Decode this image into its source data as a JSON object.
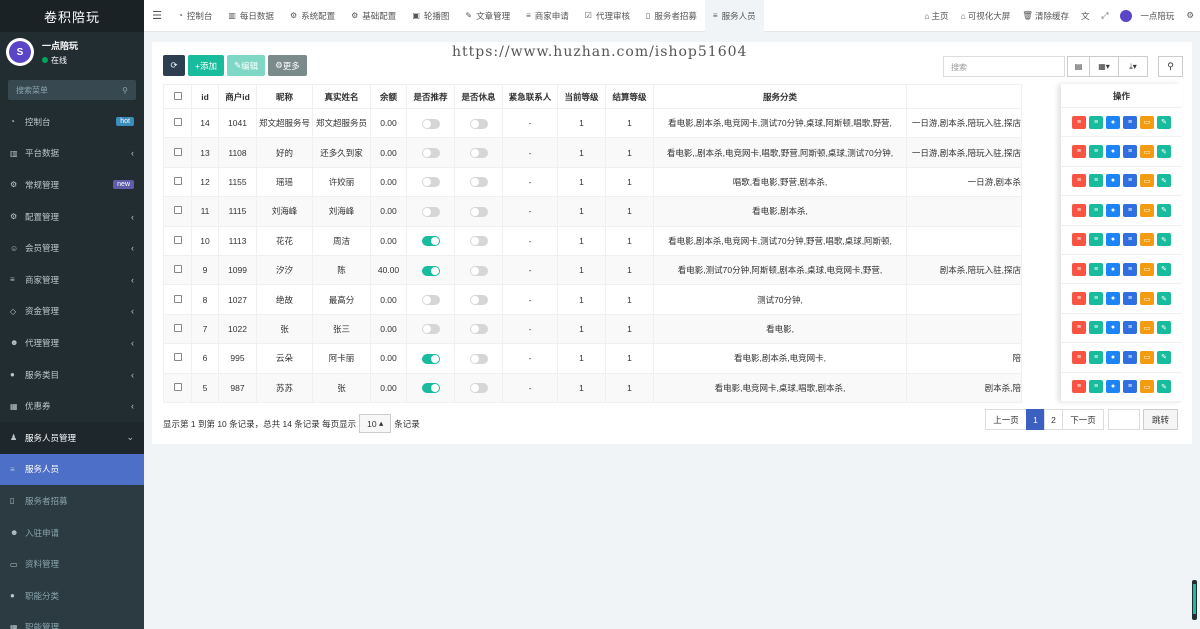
{
  "sidebar": {
    "title": "卷积陪玩",
    "user_name": "一点陪玩",
    "user_status": "在线",
    "search_placeholder": "搜索菜单",
    "items": [
      {
        "label": "控制台",
        "icon": "dashboard-icon",
        "badge": "hot"
      },
      {
        "label": "平台数据",
        "icon": "chart-icon"
      },
      {
        "label": "常规管理",
        "icon": "cogs-icon",
        "badge": "new"
      },
      {
        "label": "配置管理",
        "icon": "gear-icon"
      },
      {
        "label": "会员管理",
        "icon": "user-circle-icon"
      },
      {
        "label": "商家管理",
        "icon": "list-icon"
      },
      {
        "label": "资金管理",
        "icon": "diamond-icon"
      },
      {
        "label": "代理管理",
        "icon": "user-icon"
      },
      {
        "label": "服务类目",
        "icon": "circle-icon"
      },
      {
        "label": "优惠券",
        "icon": "calculator-icon"
      },
      {
        "label": "服务人员管理",
        "icon": "users-icon"
      },
      {
        "label": "服务人员",
        "icon": "list-icon"
      },
      {
        "label": "服务者招募",
        "icon": "mobile-icon"
      },
      {
        "label": "入驻申请",
        "icon": "user-icon"
      },
      {
        "label": "资料管理",
        "icon": "id-card-icon"
      },
      {
        "label": "职能分类",
        "icon": "circle-icon"
      },
      {
        "label": "职能管理",
        "icon": "calculator-icon"
      }
    ]
  },
  "topbar": {
    "tabs": [
      "控制台",
      "每日数据",
      "系统配置",
      "基础配置",
      "轮播图",
      "文章管理",
      "商家申请",
      "代理审核",
      "服务者招募",
      "服务人员"
    ],
    "home": "主页",
    "screen": "可视化大屏",
    "clear": "清除缓存",
    "user": "一点陪玩"
  },
  "watermark": "https://www.huzhan.com/ishop51604",
  "toolbar": {
    "add": "添加",
    "edit": "编辑",
    "more": "更多"
  },
  "search_placeholder": "搜索",
  "table": {
    "headers": [
      "id",
      "商户id",
      "昵称",
      "真实姓名",
      "余额",
      "是否推荐",
      "是否休息",
      "紧急联系人",
      "当前等级",
      "结算等级",
      "服务分类",
      ""
    ],
    "ops_header": "操作",
    "rows": [
      {
        "id": "14",
        "mid": "1041",
        "nick": "郑文超服务号",
        "real": "郑文超服务员",
        "bal": "0.00",
        "rec": false,
        "rest": false,
        "contact": "-",
        "lv": "1",
        "slv": "1",
        "cat": "看电影,剧本杀,电竞网卡,测试70分钟,桌球,阿斯顿,唱歌,野营,",
        "extra": "一日游,剧本杀,陪玩入驻,探店"
      },
      {
        "id": "13",
        "mid": "1108",
        "nick": "好的",
        "real": "还多久到家",
        "bal": "0.00",
        "rec": false,
        "rest": false,
        "contact": "-",
        "lv": "1",
        "slv": "1",
        "cat": "看电影,,剧本杀,电竞网卡,唱歌,野营,阿斯顿,桌球,测试70分钟,",
        "extra": "一日游,剧本杀,陪玩入驻,探店"
      },
      {
        "id": "12",
        "mid": "1155",
        "nick": "瑶瑶",
        "real": "许姣丽",
        "bal": "0.00",
        "rec": false,
        "rest": false,
        "contact": "-",
        "lv": "1",
        "slv": "1",
        "cat": "唱歌,看电影,野营,剧本杀,",
        "extra": "一日游,剧本杀"
      },
      {
        "id": "11",
        "mid": "1115",
        "nick": "刘海峰",
        "real": "刘海峰",
        "bal": "0.00",
        "rec": false,
        "rest": false,
        "contact": "-",
        "lv": "1",
        "slv": "1",
        "cat": "看电影,剧本杀,",
        "extra": ""
      },
      {
        "id": "10",
        "mid": "1113",
        "nick": "花花",
        "real": "周洁",
        "bal": "0.00",
        "rec": true,
        "rest": false,
        "contact": "-",
        "lv": "1",
        "slv": "1",
        "cat": "看电影,剧本杀,电竞网卡,测试70分钟,野营,唱歌,桌球,阿斯顿,",
        "extra": ""
      },
      {
        "id": "9",
        "mid": "1099",
        "nick": "汐汐",
        "real": "陈",
        "bal": "40.00",
        "rec": true,
        "rest": false,
        "contact": "-",
        "lv": "1",
        "slv": "1",
        "cat": "看电影,测试70分钟,阿斯顿,剧本杀,桌球,电竞网卡,野营,",
        "extra": "剧本杀,陪玩入驻,探店"
      },
      {
        "id": "8",
        "mid": "1027",
        "nick": "绝故",
        "real": "最高分",
        "bal": "0.00",
        "rec": false,
        "rest": false,
        "contact": "-",
        "lv": "1",
        "slv": "1",
        "cat": "测试70分钟,",
        "extra": ""
      },
      {
        "id": "7",
        "mid": "1022",
        "nick": "张",
        "real": "张三",
        "bal": "0.00",
        "rec": false,
        "rest": false,
        "contact": "-",
        "lv": "1",
        "slv": "1",
        "cat": "看电影,",
        "extra": ""
      },
      {
        "id": "6",
        "mid": "995",
        "nick": "云朵",
        "real": "阿卡丽",
        "bal": "0.00",
        "rec": true,
        "rest": false,
        "contact": "-",
        "lv": "1",
        "slv": "1",
        "cat": "看电影,剧本杀,电竞网卡,",
        "extra": "陪"
      },
      {
        "id": "5",
        "mid": "987",
        "nick": "苏苏",
        "real": "张",
        "bal": "0.00",
        "rec": true,
        "rest": false,
        "contact": "-",
        "lv": "1",
        "slv": "1",
        "cat": "看电影,电竞网卡,桌球,唱歌,剧本杀,",
        "extra": "剧本杀,陪"
      }
    ]
  },
  "footer": {
    "info_pre": "显示第 1 到第 10 条记录，总共 14 条记录 每页显示",
    "page_size": "10",
    "info_post": "条记录"
  },
  "pager": {
    "prev": "上一页",
    "p1": "1",
    "p2": "2",
    "next": "下一页",
    "jump": "跳转"
  }
}
